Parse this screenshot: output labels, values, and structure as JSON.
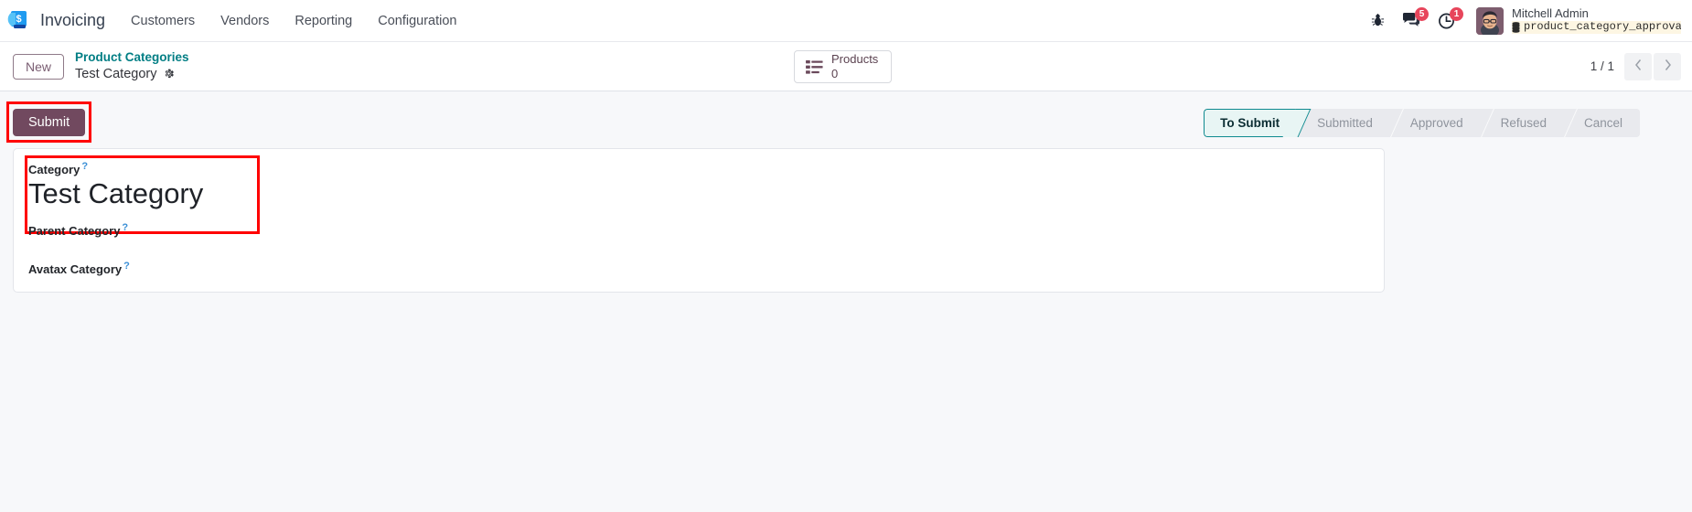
{
  "navbar": {
    "logo_icon": "odoo-invoicing-logo",
    "app_name": "Invoicing",
    "menu_items": [
      {
        "label": "Customers",
        "name": "customers"
      },
      {
        "label": "Vendors",
        "name": "vendors"
      },
      {
        "label": "Reporting",
        "name": "reporting"
      },
      {
        "label": "Configuration",
        "name": "configuration"
      }
    ],
    "system_icons": [
      {
        "name": "bug-icon",
        "badge": ""
      },
      {
        "name": "messages-icon",
        "badge": "5"
      },
      {
        "name": "activities-clock-icon",
        "badge": "1"
      }
    ],
    "user": {
      "name": "Mitchell Admin",
      "database": "product_category_approva…",
      "database_icon": "database-icon",
      "avatar_icon": "user-avatar"
    }
  },
  "control_panel": {
    "new_button": "New",
    "breadcrumb": {
      "parent": "Product Categories",
      "current": "Test Category",
      "settings_icon": "gear-icon"
    },
    "smart_button": {
      "icon": "list-view-icon",
      "label": "Products",
      "value": "0"
    },
    "pager": {
      "counter": "1 / 1",
      "prev_icon": "chevron-left-icon",
      "next_icon": "chevron-right-icon"
    }
  },
  "form": {
    "submit_button": "Submit",
    "statusbar": [
      {
        "label": "To Submit",
        "active": true
      },
      {
        "label": "Submitted",
        "active": false
      },
      {
        "label": "Approved",
        "active": false
      },
      {
        "label": "Refused",
        "active": false
      },
      {
        "label": "Cancel",
        "active": false
      }
    ],
    "fields": [
      {
        "label": "Category",
        "value": "Test Category",
        "help": "?"
      },
      {
        "label": "Parent Category",
        "value": "",
        "help": "?"
      },
      {
        "label": "Avatax Category",
        "value": "",
        "help": "?"
      }
    ]
  },
  "colors": {
    "accent_teal": "#017e84",
    "brand_purple": "#71495f",
    "badge_red": "#e7455b",
    "highlight_red": "#ff0000",
    "page_bg": "#f7f8fa",
    "stage_active_bg": "#e8f5f4"
  }
}
